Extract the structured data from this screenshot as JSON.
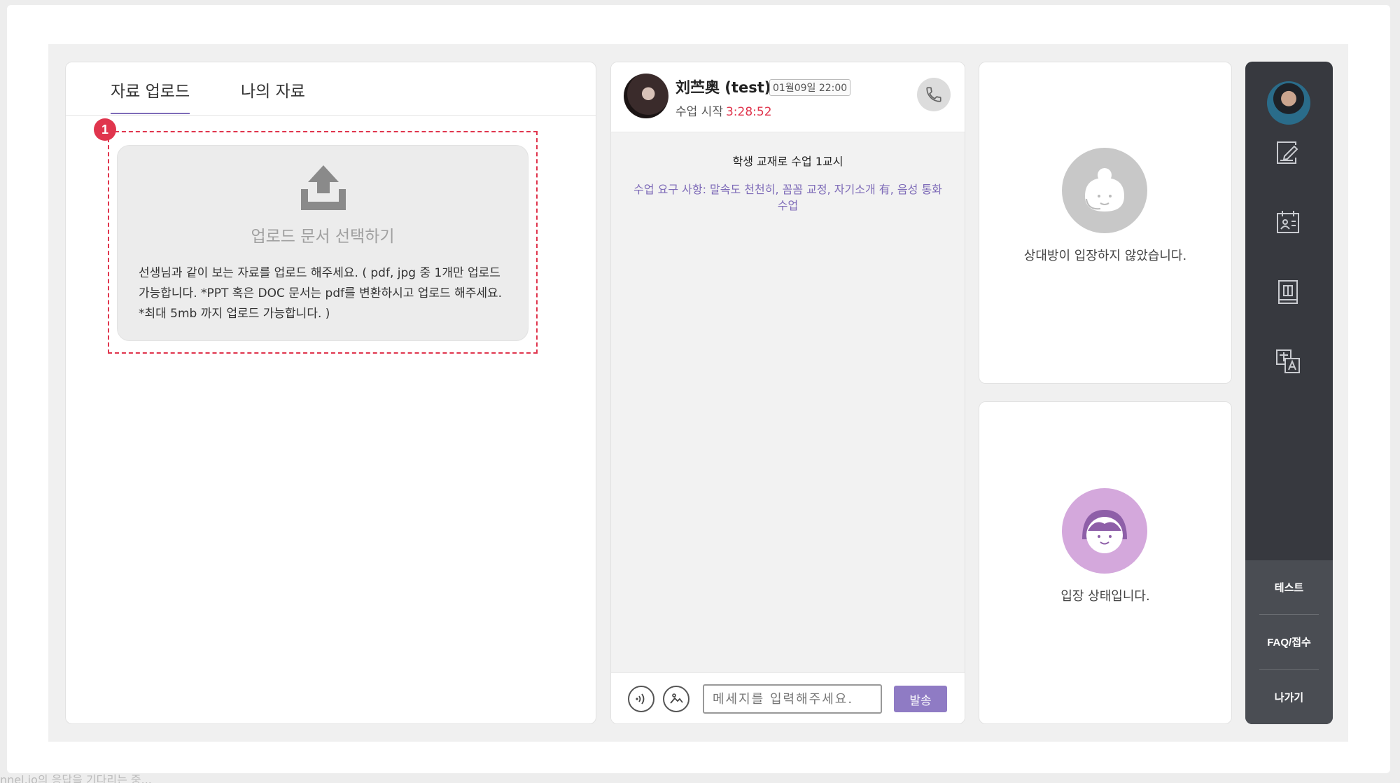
{
  "left_panel": {
    "tabs": [
      {
        "label": "자료 업로드",
        "active": true
      },
      {
        "label": "나의 자료",
        "active": false
      }
    ],
    "step_badge": "1",
    "upload": {
      "title": "업로드 문서 선택하기",
      "description": "선생님과 같이 보는 자료를 업로드 해주세요. ( pdf, jpg 중 1개만 업로드 가능합니다. *PPT 혹은 DOC 문서는 pdf를 변환하시고 업로드 해주세요. *최대 5mb 까지 업로드 가능합니다. )"
    }
  },
  "chat": {
    "name": "刘苎奥 (test)",
    "date": "01월09일 22:00",
    "start_label": "수업 시작",
    "timer": "3:28:52",
    "lesson_title": "학생 교재로 수업 1교시",
    "request": "수업 요구 사항: 말속도 천천히, 꼼꼼 교정, 자기소개 有, 음성 통화 수업",
    "input_placeholder": "메세지를 입력해주세요.",
    "send_label": "발송"
  },
  "video": {
    "other_status": "상대방이 입장하지 않았습니다.",
    "self_status": "입장 상태입니다."
  },
  "sidebar": {
    "buttons": [
      "테스트",
      "FAQ/접수",
      "나가기"
    ]
  },
  "status_bar": "nnel.io의 응답을 기다리는 중..."
}
